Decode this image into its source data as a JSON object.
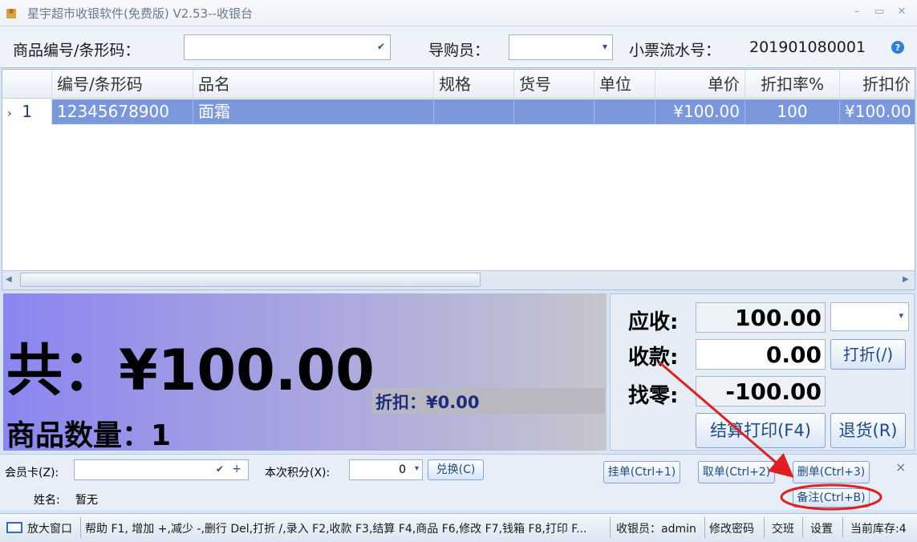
{
  "window": {
    "title": "星宇超市收银软件(免费版) V2.53--收银台",
    "min": "–",
    "max": "▭",
    "close": "✕"
  },
  "topbar": {
    "barcode_label": "商品编号/条形码：",
    "barcode_value": "",
    "guide_label": "导购员：",
    "guide_value": "",
    "receipt_label": "小票流水号：",
    "receipt_value": "201901080001"
  },
  "grid": {
    "columns": [
      "编号/条形码",
      "品名",
      "规格",
      "货号",
      "单位",
      "单价",
      "折扣率%",
      "折扣价"
    ],
    "rows": [
      {
        "index": "1",
        "barcode": "12345678900",
        "name": "面霜",
        "spec": "",
        "item_no": "",
        "unit": "",
        "price": "¥100.00",
        "discount_rate": "100",
        "discount_price": "¥100.00"
      }
    ]
  },
  "total": {
    "total_text": "共：¥100.00",
    "discount_text": "折扣：¥0.00",
    "qty_text": "商品数量：1"
  },
  "calc": {
    "receivable_label": "应收:",
    "receivable_value": "100.00",
    "paid_label": "收款:",
    "paid_value": "0.00",
    "change_label": "找零:",
    "change_value": "-100.00",
    "discount_btn": "打折(/)",
    "checkout_btn": "结算打印(F4)",
    "return_btn": "退货(R)"
  },
  "member": {
    "card_label": "会员卡(Z):",
    "card_value": "",
    "points_label": "本次积分(X):",
    "points_value": "0",
    "exchange_btn": "兑换(C)",
    "name_label": "姓名:",
    "name_value": "暂无",
    "hold_btn": "挂单(Ctrl+1)",
    "retrieve_btn": "取单(Ctrl+2)",
    "delete_btn": "删单(Ctrl+3)",
    "note_btn": "备注(Ctrl+B)",
    "close_x": "×"
  },
  "status": {
    "enlarge": "放大窗口",
    "help": "帮助 F1, 增加 +,减少 -,删行 Del,打折 /,录入 F2,收款 F3,结算 F4,商品 F6,修改 F7,钱箱 F8,打印 F...",
    "cashier": "收银员：admin",
    "change_pwd": "修改密码",
    "shift": "交班",
    "settings": "设置",
    "stock": "当前库存:4"
  },
  "colors": {
    "highlight_red": "#e02020",
    "row_selected": "#7c98dc"
  }
}
